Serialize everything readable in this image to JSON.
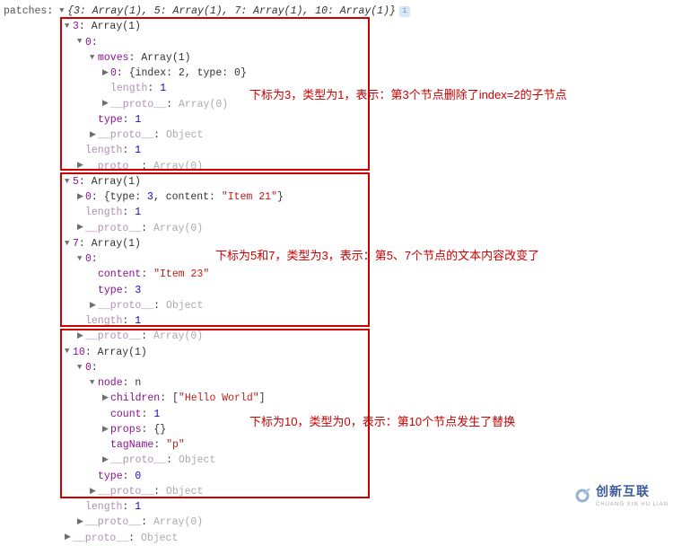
{
  "top": {
    "label": "patches",
    "summary": "{3: Array(1), 5: Array(1), 7: Array(1), 10: Array(1)}"
  },
  "box1": {
    "header_key": "3",
    "header_val": "Array(1)",
    "item0_key": "0",
    "moves_key": "moves",
    "moves_val": "Array(1)",
    "moves_item0_key": "0",
    "moves_item0_val": "{index: 2, type: 0}",
    "moves_len_key": "length",
    "moves_len_val": "1",
    "moves_proto_key": "__proto__",
    "moves_proto_val": "Array(0)",
    "type_key": "type",
    "type_val": "1",
    "item0_proto_key": "__proto__",
    "item0_proto_val": "Object",
    "length_key": "length",
    "length_val": "1",
    "proto_key": "__proto__",
    "proto_val": "Array(0)",
    "note": "下标为3，类型为1，表示：第3个节点删除了index=2的子节点"
  },
  "box2": {
    "h5_key": "5",
    "h5_val": "Array(1)",
    "h5_item0_key": "0",
    "h5_item0_val": "{type: 3, content: \"Item 21\"}",
    "h5_len_key": "length",
    "h5_len_val": "1",
    "h5_proto_key": "__proto__",
    "h5_proto_val": "Array(0)",
    "h7_key": "7",
    "h7_val": "Array(1)",
    "h7_item0_key": "0",
    "h7_content_key": "content",
    "h7_content_val": "\"Item 23\"",
    "h7_type_key": "type",
    "h7_type_val": "3",
    "h7_item0_proto_key": "__proto__",
    "h7_item0_proto_val": "Object",
    "h7_len_key": "length",
    "h7_len_val": "1",
    "h7_proto_key": "__proto__",
    "h7_proto_val": "Array(0)",
    "note": "下标为5和7，类型为3，表示：第5、7个节点的文本内容改变了"
  },
  "box3": {
    "h10_key": "10",
    "h10_val": "Array(1)",
    "item0_key": "0",
    "node_key": "node",
    "node_val": "n",
    "children_key": "children",
    "children_val": "[\"Hello World\"]",
    "count_key": "count",
    "count_val": "1",
    "props_key": "props",
    "props_val": "{}",
    "tagName_key": "tagName",
    "tagName_val": "\"p\"",
    "node_proto_key": "__proto__",
    "node_proto_val": "Object",
    "type_key": "type",
    "type_val": "0",
    "item0_proto_key": "__proto__",
    "item0_proto_val": "Object",
    "length_key": "length",
    "length_val": "1",
    "proto_key": "__proto__",
    "proto_val": "Array(0)",
    "note": "下标为10，类型为0，表示：第10个节点发生了替换"
  },
  "footer_proto_key": "__proto__",
  "footer_proto_val": "Object",
  "watermark": {
    "main": "创新互联",
    "sub": "CHUANG XIN HU LIAN"
  }
}
